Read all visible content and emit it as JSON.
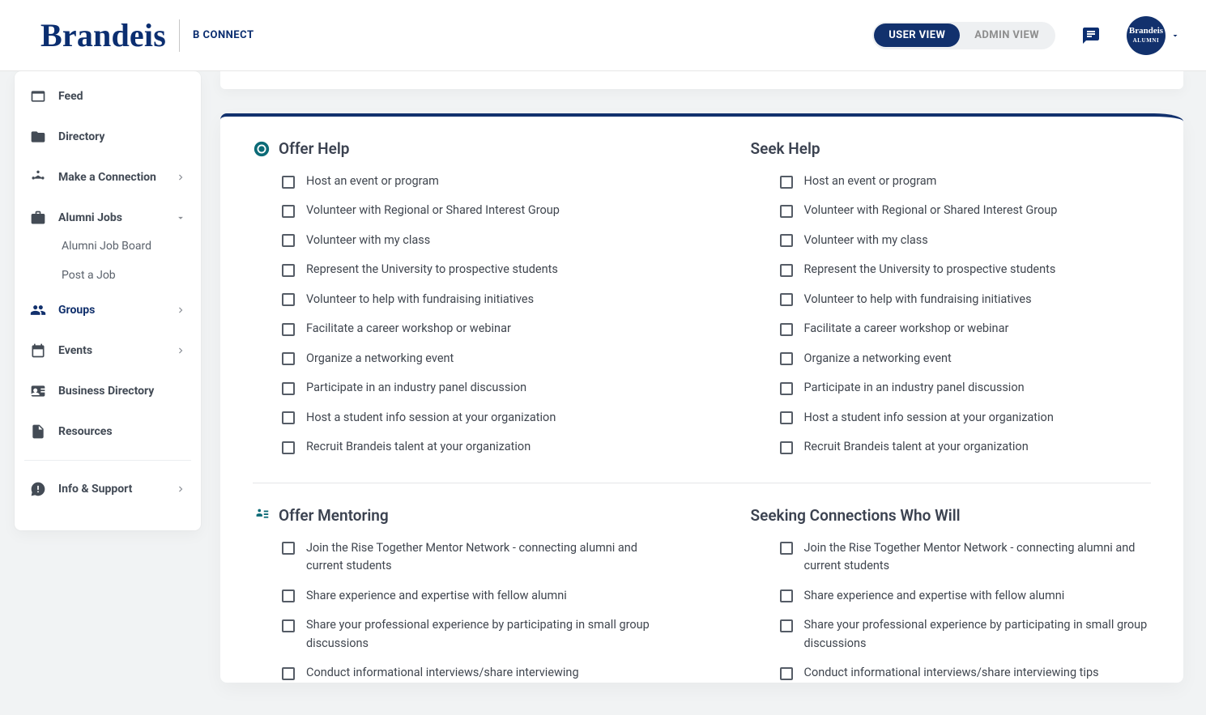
{
  "header": {
    "brand_word": "Brandeis",
    "brand_sub": "B CONNECT",
    "user_view": "USER VIEW",
    "admin_view": "ADMIN VIEW",
    "avatar_line1": "Brandeis",
    "avatar_line2": "ALUMNI"
  },
  "sidebar": {
    "feed": "Feed",
    "directory": "Directory",
    "make_connection": "Make a Connection",
    "alumni_jobs": "Alumni Jobs",
    "alumni_job_board": "Alumni Job Board",
    "post_a_job": "Post a Job",
    "groups": "Groups",
    "events": "Events",
    "business_directory": "Business Directory",
    "resources": "Resources",
    "info_support": "Info & Support"
  },
  "sections": {
    "offer_help": "Offer Help",
    "seek_help": "Seek Help",
    "offer_mentoring": "Offer Mentoring",
    "seek_mentoring": "Seeking Connections Who Will"
  },
  "help_items": [
    "Host an event or program",
    "Volunteer with Regional or Shared Interest Group",
    "Volunteer with my class",
    "Represent the University to prospective students",
    "Volunteer to help with fundraising initiatives",
    "Facilitate a career workshop or webinar",
    "Organize a networking event",
    "Participate in an industry panel discussion",
    "Host a student info session at your organization",
    "Recruit Brandeis talent at your organization"
  ],
  "mentor_items_left": [
    "Join the Rise Together Mentor Network - connecting alumni and current students",
    "Share experience and expertise with fellow alumni",
    "Share your professional experience by participating in small group discussions",
    "Conduct informational interviews/share interviewing"
  ],
  "mentor_items_right": [
    "Join the Rise Together Mentor Network - connecting alumni and current students",
    "Share experience and expertise with fellow alumni",
    "Share your professional experience by participating in small group discussions",
    "Conduct informational interviews/share interviewing tips"
  ]
}
